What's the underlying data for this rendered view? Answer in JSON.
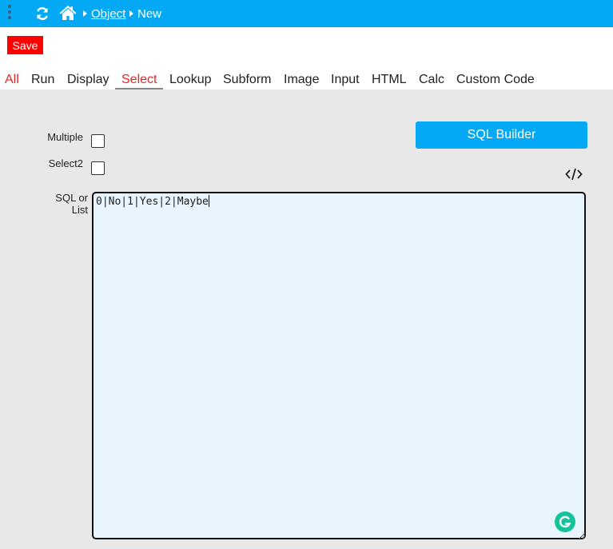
{
  "header": {
    "breadcrumb_link": "Object",
    "breadcrumb_current": "New"
  },
  "toolbar": {
    "save_label": "Save"
  },
  "tabs": [
    {
      "label": "All"
    },
    {
      "label": "Run"
    },
    {
      "label": "Display"
    },
    {
      "label": "Select",
      "active": true
    },
    {
      "label": "Lookup"
    },
    {
      "label": "Subform"
    },
    {
      "label": "Image"
    },
    {
      "label": "Input"
    },
    {
      "label": "HTML"
    },
    {
      "label": "Calc"
    },
    {
      "label": "Custom Code"
    }
  ],
  "form": {
    "multiple_label": "Multiple",
    "multiple_checked": false,
    "select2_label": "Select2",
    "select2_checked": false,
    "sql_builder_label": "SQL Builder",
    "sql_label": "SQL or List",
    "sql_value": "0|No|1|Yes|2|Maybe"
  },
  "icons": [
    "kebab-menu-icon",
    "refresh-icon",
    "home-icon",
    "caret-right-icon",
    "code-icon",
    "grammarly-icon"
  ],
  "colors": {
    "accent": "#03a9f4",
    "save": "#ff0000",
    "active_tab": "#e52525",
    "textarea_bg": "#e8f5fe"
  }
}
